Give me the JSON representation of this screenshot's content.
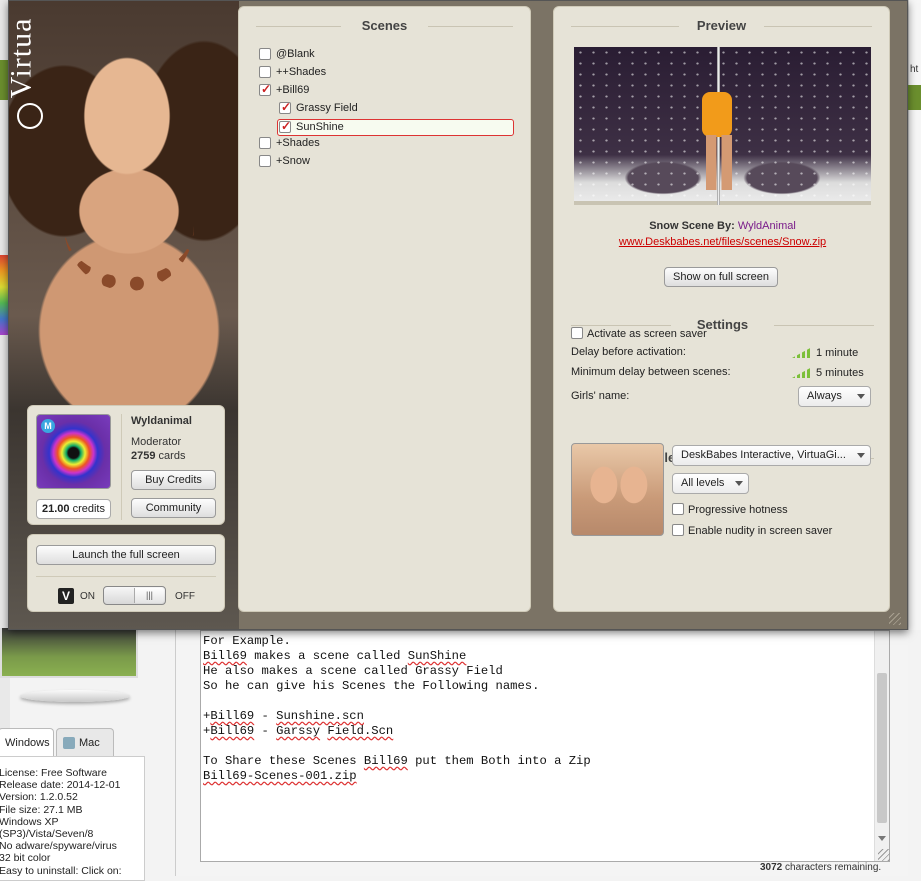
{
  "background": {
    "right_fragment": "ht",
    "os_tabs": [
      {
        "label": "Windows"
      },
      {
        "label": "Mac",
        "icon": "mac-icon"
      }
    ],
    "info_lines": [
      "License: Free Software",
      "Release date: 2014-12-01",
      "Version: 1.2.0.52",
      "File size: 27.1 MB",
      "Windows XP",
      "(SP3)/Vista/Seven/8",
      "No adware/spyware/virus",
      "32 bit color",
      "Easy to uninstall: Click on:"
    ],
    "editor_lines": [
      "For Example.",
      "Bill69 makes a scene called SunShine",
      "He also makes a scene called Grassy Field",
      "So he can give his Scenes the Following names.",
      "",
      "+Bill69 - Sunshine.scn",
      "+Bill69 - Garssy Field.Scn",
      "",
      "To Share these Scenes Bill69 put them Both into a Zip",
      "Bill69-Scenes-001.zip"
    ],
    "chars_count": "3072",
    "chars_suffix": " characters remaining."
  },
  "app": {
    "brand_text": "Virtua",
    "user": {
      "name": "Wyldanimal",
      "role": "Moderator",
      "cards": "2759",
      "cards_suffix": " cards",
      "credits_value": "21.00",
      "credits_suffix": " credits",
      "badge": "M",
      "buy_credits_label": "Buy Credits",
      "community_label": "Community"
    },
    "launch": {
      "button_label": "Launch the full screen",
      "on_label": "ON",
      "off_label": "OFF",
      "logo_letter": "V",
      "toggle_state": "on",
      "knob_glyph": "|||"
    },
    "scenes": {
      "title": "Scenes",
      "items": [
        {
          "label": "@Blank",
          "checked": false
        },
        {
          "label": "++Shades",
          "checked": false
        },
        {
          "label": "+Bill69",
          "checked": true
        },
        {
          "label": "Grassy Field",
          "checked": true
        },
        {
          "label": "SunShine",
          "checked": true,
          "selected": true
        },
        {
          "label": "+Shades",
          "checked": false
        },
        {
          "label": "+Snow",
          "checked": false
        }
      ]
    },
    "preview": {
      "title": "Preview",
      "scene_by_prefix": "Snow Scene By: ",
      "scene_author": "WyldAnimal",
      "scene_link": "www.Deskbabes.net/files/scenes/Snow.zip",
      "full_screen_label": "Show on full screen"
    },
    "settings": {
      "title": "Settings",
      "screensaver_label": "Activate as screen saver",
      "screensaver_checked": false,
      "delay_label": "Delay before activation:",
      "delay_value": "1 minute",
      "min_delay_label": "Minimum delay between scenes:",
      "min_delay_value": "5 minutes",
      "girls_name_label": "Girls' name:",
      "girls_name_value": "Always"
    },
    "collections": {
      "title": "Collections and eroticism",
      "collection_value": "DeskBabes Interactive, VirtuaGi...",
      "level_value": "All levels",
      "progressive_label": "Progressive hotness",
      "progressive_checked": false,
      "nudity_label": "Enable nudity in screen saver",
      "nudity_checked": false
    },
    "colors": {
      "link": "#cc0000",
      "author": "#7a1b8a",
      "panel_bg": "#e6e3d7",
      "window_bg": "#7b7365",
      "check": "#cc2222"
    }
  }
}
